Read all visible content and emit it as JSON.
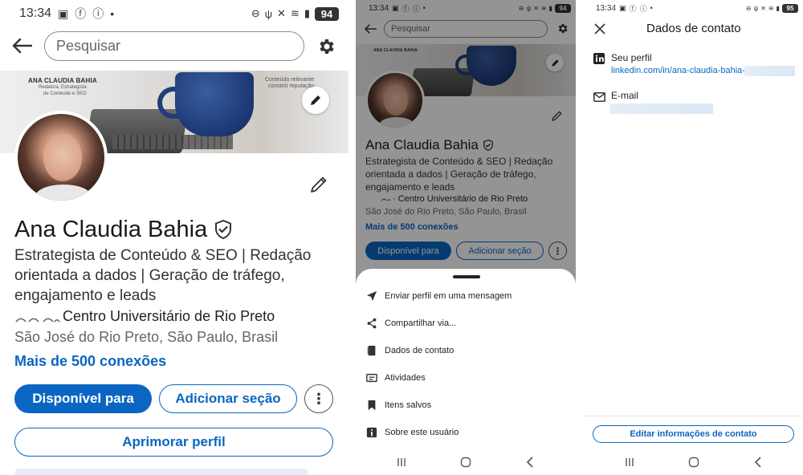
{
  "status": {
    "time": "13:34",
    "battery_p1": "94",
    "battery_p2": "94",
    "battery_p3": "95"
  },
  "profile": {
    "search_placeholder": "Pesquisar",
    "banner_name": "ANA CLAUDIA BAHIA",
    "banner_sub_1": "Redatora, Estrategista",
    "banner_sub_2": "de Conteúdo e SEO",
    "banner_right_1": "Conteúdo relevante",
    "banner_right_2": "constrói reputação.",
    "name": "Ana Claudia Bahia",
    "headline_1": "Estrategista de Conteúdo & SEO | Redação",
    "headline_2": "orientada a dados | Geração de tráfego,",
    "headline_3": "engajamento e leads",
    "education_p1": "Centro Universitário de Rio Preto",
    "education_p2": "· Centro Universitário de Rio Preto",
    "location": "São José do Rio Preto, São Paulo, Brasil",
    "connections": "Mais de 500 conexões",
    "btn_available": "Disponível para",
    "btn_add_section": "Adicionar seção",
    "btn_improve": "Aprimorar perfil"
  },
  "sheet": {
    "items": [
      {
        "label": "Enviar perfil em uma mensagem",
        "icon": "send-icon"
      },
      {
        "label": "Compartilhar via...",
        "icon": "share-icon"
      },
      {
        "label": "Dados de contato",
        "icon": "contact-card-icon"
      },
      {
        "label": "Atividades",
        "icon": "activity-icon"
      },
      {
        "label": "Itens salvos",
        "icon": "bookmark-icon"
      },
      {
        "label": "Sobre este usuário",
        "icon": "info-icon"
      }
    ]
  },
  "contact": {
    "title": "Dados de contato",
    "profile_label": "Seu perfil",
    "profile_link": "linkedin.com/in/ana-claudia-bahia-",
    "email_label": "E-mail",
    "edit_button": "Editar informações de contato"
  },
  "colors": {
    "brand_blue": "#0a66c2"
  }
}
